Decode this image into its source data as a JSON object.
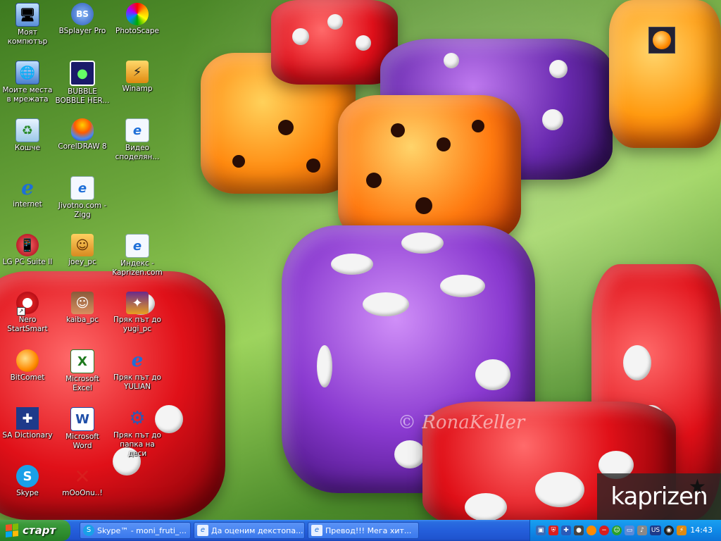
{
  "desktop": {
    "icons": [
      {
        "label": "Моят компютър",
        "icon": "my-computer-icon",
        "shortcut": false
      },
      {
        "label": "BSplayer Pro",
        "icon": "bsplayer-icon",
        "shortcut": false
      },
      {
        "label": "PhotoScape",
        "icon": "photoscape-icon",
        "shortcut": false
      },
      {
        "label": "Моите места в мрежата",
        "icon": "network-places-icon",
        "shortcut": false
      },
      {
        "label": "BUBBLE BOBBLE HER...",
        "icon": "bubble-bobble-icon",
        "shortcut": false
      },
      {
        "label": "Winamp",
        "icon": "winamp-icon",
        "shortcut": true
      },
      {
        "label": "Кошче",
        "icon": "recycle-bin-icon",
        "shortcut": false
      },
      {
        "label": "CorelDRAW 8",
        "icon": "coreldraw-icon",
        "shortcut": true
      },
      {
        "label": "Видео споделян...",
        "icon": "internet-shortcut-icon",
        "shortcut": true
      },
      {
        "label": "internet",
        "icon": "internet-explorer-icon",
        "shortcut": false
      },
      {
        "label": "Jivotno.com - Zigg",
        "icon": "internet-shortcut-icon",
        "shortcut": true
      },
      {
        "label": "LG PC Suite II",
        "icon": "lg-phone-icon",
        "shortcut": false
      },
      {
        "label": "joey_pc",
        "icon": "anime-character-icon",
        "shortcut": false
      },
      {
        "label": "Индекс - Kaprizen.com",
        "icon": "internet-shortcut-icon",
        "shortcut": true
      },
      {
        "label": "Nero StartSmart",
        "icon": "nero-icon",
        "shortcut": true
      },
      {
        "label": "kaiba_pc",
        "icon": "anime-character-icon",
        "shortcut": true
      },
      {
        "label": "Пряк път до yugi_pc",
        "icon": "yugioh-icon",
        "shortcut": true
      },
      {
        "label": "BitComet",
        "icon": "bitcomet-icon",
        "shortcut": true
      },
      {
        "label": "Microsoft Excel",
        "icon": "excel-icon",
        "shortcut": true
      },
      {
        "label": "Пряк път до YULIAN",
        "icon": "ie-shortcut-icon",
        "shortcut": true
      },
      {
        "label": "SA Dictionary",
        "icon": "uk-flag-icon",
        "shortcut": true
      },
      {
        "label": "Microsoft Word",
        "icon": "word-icon",
        "shortcut": true
      },
      {
        "label": "Пряк път до папка на деси",
        "icon": "gear-folder-icon",
        "shortcut": true
      },
      {
        "label": "Skype",
        "icon": "skype-icon",
        "shortcut": true
      },
      {
        "label": "mOoOnu..!",
        "icon": "red-x-icon",
        "shortcut": false
      }
    ],
    "watermark": "© RonaKeller",
    "logo_text": "kaprizen"
  },
  "taskbar": {
    "start_label": "старт",
    "tasks": [
      {
        "label": "Skype™ - moni_fruti_...",
        "icon": "skype-icon"
      },
      {
        "label": "Да оценим декстопа...",
        "icon": "ie-window-icon"
      },
      {
        "label": "Превод!!! Мега хит...",
        "icon": "ie-window-icon"
      }
    ],
    "tray": {
      "language": "US",
      "clock": "14:43"
    }
  }
}
